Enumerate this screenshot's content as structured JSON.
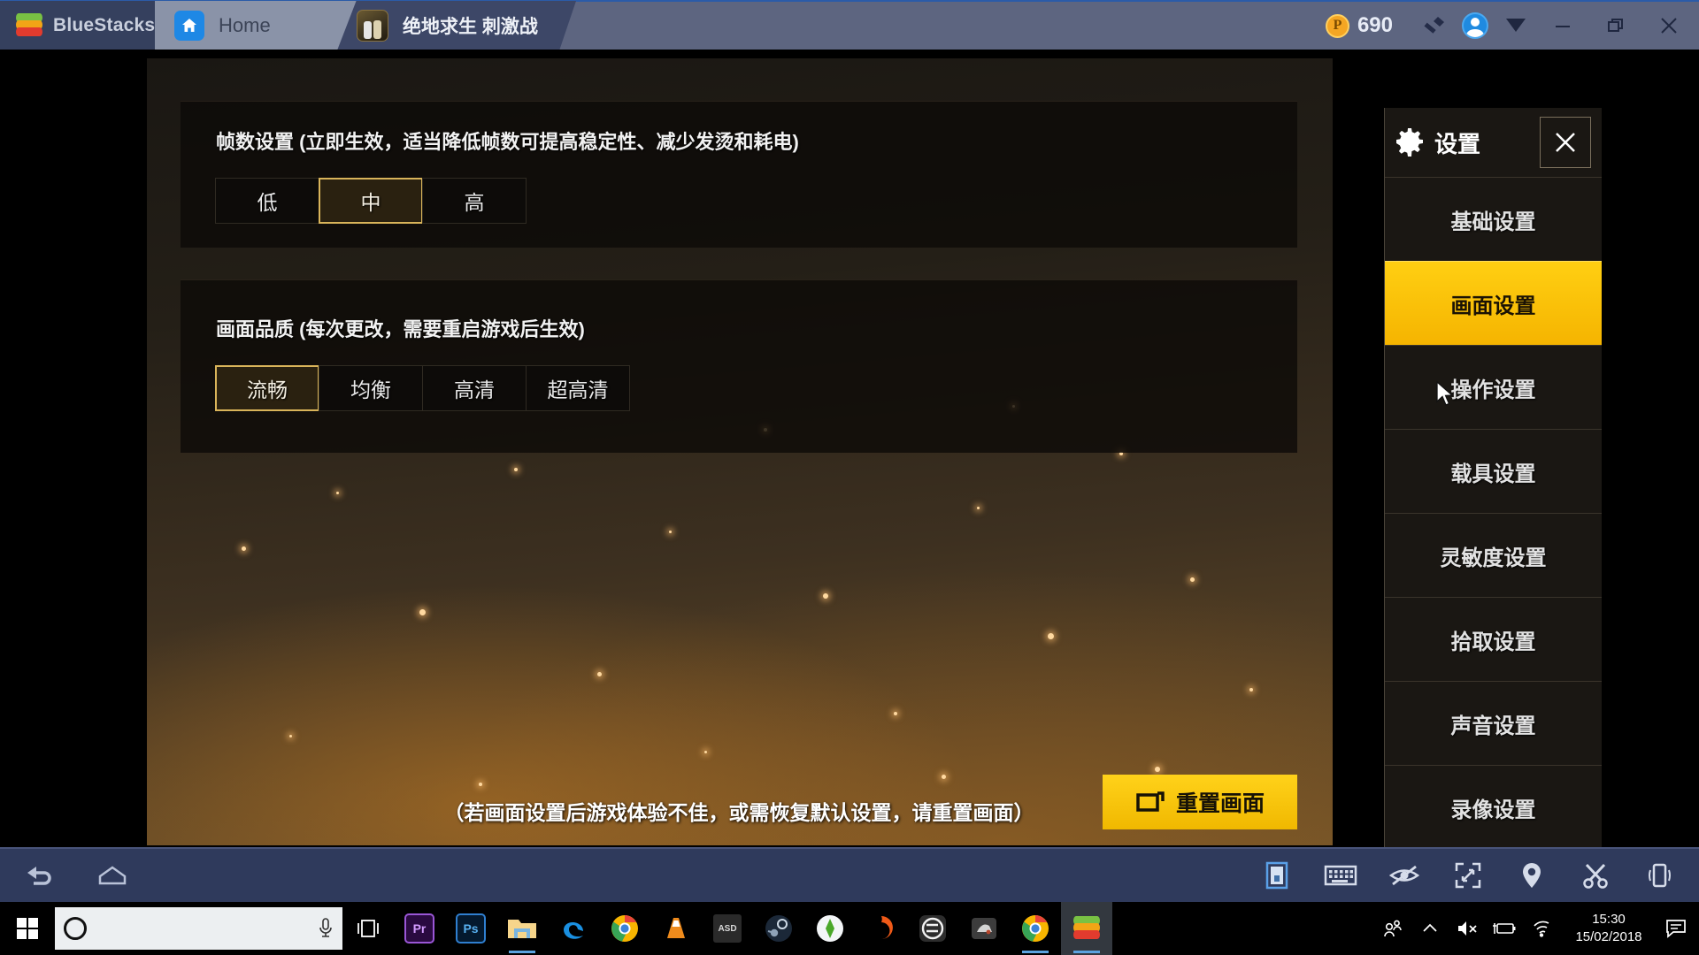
{
  "titlebar": {
    "brand": "BlueStacks",
    "brand_logo_icon": "bluestacks-logo-icon",
    "tabs": [
      {
        "label": "Home",
        "icon": "home-icon",
        "active": false
      },
      {
        "label": "绝地求生 刺激战",
        "icon": "game-app-icon",
        "active": true
      }
    ],
    "points": {
      "value": "690",
      "symbol": "P",
      "icon": "coin-icon"
    },
    "buttons": [
      {
        "name": "brush-tool-icon"
      },
      {
        "name": "user-avatar-icon"
      },
      {
        "name": "chevron-down-icon"
      },
      {
        "name": "minimize-button"
      },
      {
        "name": "maximize-button"
      },
      {
        "name": "close-button"
      }
    ]
  },
  "game": {
    "sections": [
      {
        "id": "fps",
        "label": "帧数设置 (立即生效，适当降低帧数可提高稳定性、减少发烫和耗电)",
        "options": [
          "低",
          "中",
          "高"
        ],
        "selected": "中"
      },
      {
        "id": "quality",
        "label": "画面品质 (每次更改，需要重启游戏后生效)",
        "options": [
          "流畅",
          "均衡",
          "高清",
          "超高清"
        ],
        "selected": "流畅"
      }
    ],
    "hint": "（若画面设置后游戏体验不佳，或需恢复默认设置，请重置画面）",
    "reset_button": {
      "label": "重置画面",
      "icon": "reset-screen-icon"
    }
  },
  "settings_panel": {
    "title": "设置",
    "gear_icon": "gear-icon",
    "close_icon": "close-icon",
    "items": [
      {
        "label": "基础设置",
        "active": false
      },
      {
        "label": "画面设置",
        "active": true
      },
      {
        "label": "操作设置",
        "active": false
      },
      {
        "label": "载具设置",
        "active": false
      },
      {
        "label": "灵敏度设置",
        "active": false
      },
      {
        "label": "拾取设置",
        "active": false
      },
      {
        "label": "声音设置",
        "active": false
      },
      {
        "label": "录像设置",
        "active": false
      }
    ]
  },
  "emulator_toolbar": {
    "left": [
      {
        "name": "back-icon"
      },
      {
        "name": "home-icon"
      }
    ],
    "right": [
      {
        "name": "device-panel-icon",
        "selected": true
      },
      {
        "name": "keyboard-icon"
      },
      {
        "name": "eye-slash-icon"
      },
      {
        "name": "fullscreen-icon"
      },
      {
        "name": "location-pin-icon"
      },
      {
        "name": "scissors-icon"
      },
      {
        "name": "shake-device-icon"
      }
    ]
  },
  "taskbar": {
    "start_icon": "windows-start-icon",
    "cortana_icon": "cortana-circle-icon",
    "search_placeholder": "",
    "mic_icon": "microphone-icon",
    "apps": [
      {
        "name": "task-view-icon",
        "label": "",
        "running": false
      },
      {
        "name": "premiere-pro-icon",
        "label": "Pr",
        "running": false
      },
      {
        "name": "photoshop-icon",
        "label": "Ps",
        "running": false
      },
      {
        "name": "file-explorer-icon",
        "label": "",
        "running": true
      },
      {
        "name": "edge-icon",
        "label": "e",
        "running": false
      },
      {
        "name": "chrome-icon",
        "label": "",
        "running": false
      },
      {
        "name": "vlc-icon",
        "label": "",
        "running": false
      },
      {
        "name": "asd-app-icon",
        "label": "ASD",
        "running": false
      },
      {
        "name": "steam-icon",
        "label": "",
        "running": false
      },
      {
        "name": "sims-icon",
        "label": "",
        "running": false
      },
      {
        "name": "origin-icon",
        "label": "",
        "running": false
      },
      {
        "name": "epic-games-icon",
        "label": "",
        "running": false
      },
      {
        "name": "grey-app-icon",
        "label": "",
        "running": false
      },
      {
        "name": "chrome-window-icon",
        "label": "",
        "running": true
      },
      {
        "name": "bluestacks-taskbar-icon",
        "label": "",
        "running": true
      }
    ],
    "tray": [
      {
        "name": "people-icon"
      },
      {
        "name": "show-hidden-icons-icon"
      },
      {
        "name": "volume-muted-icon"
      },
      {
        "name": "battery-charging-icon"
      },
      {
        "name": "wifi-icon"
      }
    ],
    "clock": {
      "time": "15:30",
      "date": "15/02/2018"
    },
    "action_center_icon": "action-center-icon"
  },
  "colors": {
    "accent_gold": "#f5b400",
    "titlebar_bg": "#5d6580",
    "brand_bg": "#35405e",
    "panel_bg": "#1a1713",
    "toolbar_bg": "#2f3a5c"
  }
}
